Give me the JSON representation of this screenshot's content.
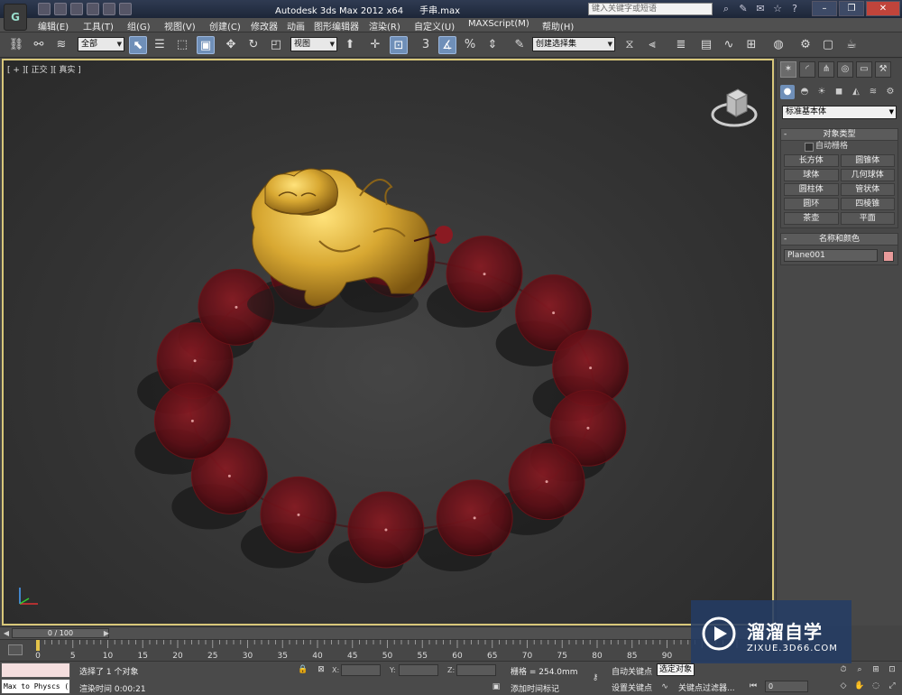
{
  "titlebar": {
    "app_title": "Autodesk 3ds Max  2012 x64",
    "file_name": "手串.max",
    "search_placeholder": "键入关键字或短语",
    "logo_label": "G"
  },
  "menu": [
    {
      "id": "edit",
      "label": "编辑(E)"
    },
    {
      "id": "tools",
      "label": "工具(T)"
    },
    {
      "id": "group",
      "label": "组(G)"
    },
    {
      "id": "views",
      "label": "视图(V)"
    },
    {
      "id": "create",
      "label": "创建(C)"
    },
    {
      "id": "modifiers",
      "label": "修改器"
    },
    {
      "id": "animation",
      "label": "动画"
    },
    {
      "id": "graph-editors",
      "label": "图形编辑器"
    },
    {
      "id": "rendering",
      "label": "渲染(R)"
    },
    {
      "id": "customize",
      "label": "自定义(U)"
    },
    {
      "id": "maxscript",
      "label": "MAXScript(M)"
    },
    {
      "id": "help",
      "label": "帮助(H)"
    }
  ],
  "toolbar": {
    "selection_filter": "全部",
    "reference_coord": "视图",
    "named_selection": "创建选择集"
  },
  "viewport": {
    "label": "[ + ][ 正交 ][ 真实 ]",
    "border_color": "#d8c77a",
    "scene": {
      "object": "pixiu-charm-with-bead-bracelet",
      "bead_color": "#6e1218",
      "charm_color": "#d8a832"
    }
  },
  "command_panel": {
    "category_dropdown": "标准基本体",
    "object_type": {
      "title": "对象类型",
      "autogrid": "自动栅格",
      "buttons": [
        "长方体",
        "圆锥体",
        "球体",
        "几何球体",
        "圆柱体",
        "管状体",
        "圆环",
        "四棱锥",
        "茶壶",
        "平面"
      ]
    },
    "name_color": {
      "title": "名称和颜色",
      "name": "Plane001",
      "color": "#e89a9a"
    }
  },
  "timeline": {
    "slider": "0 / 100",
    "ticks": [
      "0",
      "5",
      "10",
      "15",
      "20",
      "25",
      "30",
      "35",
      "40",
      "45",
      "50",
      "55",
      "60",
      "65",
      "70",
      "75",
      "80",
      "85",
      "90"
    ]
  },
  "status": {
    "maxscript_text": "Max to Physcs (",
    "selected": "选择了 1 个对象",
    "render_time": "渲染时间  0:00:21",
    "x_label": "X:",
    "y_label": "Y:",
    "z_label": "Z:",
    "grid": "栅格 = 254.0mm",
    "add_time_tag": "添加时间标记",
    "auto_key": "自动关键点",
    "set_key": "设置关键点",
    "selected_dropdown": "选定对象",
    "key_filters": "关键点过滤器...",
    "frame": "0"
  },
  "watermark": {
    "title": "溜溜自学",
    "subtitle": "ZIXUE.3D66.COM"
  }
}
